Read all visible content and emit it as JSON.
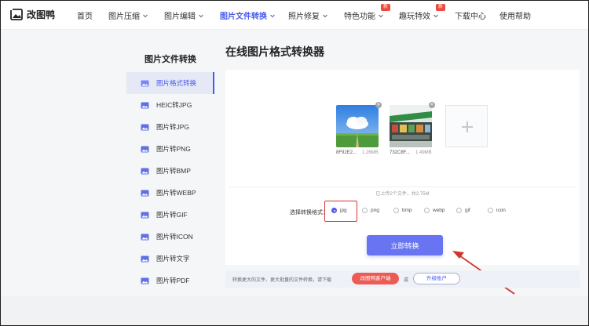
{
  "header": {
    "logo_text": "改图鸭",
    "nav": [
      {
        "label": "首页"
      },
      {
        "label": "图片压缩"
      },
      {
        "label": "图片编辑"
      },
      {
        "label": "图片文件转换"
      },
      {
        "label": "照片修复"
      },
      {
        "label": "特色功能"
      },
      {
        "label": "趣玩特效"
      },
      {
        "label": "下载中心"
      },
      {
        "label": "使用帮助"
      }
    ],
    "badge_new": "新"
  },
  "sidebar": {
    "title": "图片文件转换",
    "items": [
      {
        "label": "图片格式转换"
      },
      {
        "label": "HEIC转JPG"
      },
      {
        "label": "图片转JPG"
      },
      {
        "label": "图片转PNG"
      },
      {
        "label": "图片转BMP"
      },
      {
        "label": "图片转WEBP"
      },
      {
        "label": "图片转GIF"
      },
      {
        "label": "图片转ICON"
      },
      {
        "label": "图片转文字"
      },
      {
        "label": "图片转PDF"
      }
    ]
  },
  "main": {
    "title": "在线图片格式转换器",
    "files": [
      {
        "name": "8F92E2...",
        "size": "1.26MB"
      },
      {
        "name": "732C8F...",
        "size": "1.49MB"
      }
    ],
    "upload_summary": "已上传2个文件，共2.75M",
    "format_label": "选择转换格式：",
    "formats": [
      "jpg",
      "png",
      "bmp",
      "webp",
      "gif",
      "icon"
    ],
    "selected_format": "jpg",
    "convert_button": "立即转换"
  },
  "bottom": {
    "prompt": "转换更大的文件、更大批量的文件转换，请下载",
    "client_button": "改图鸭客户端",
    "or": "或",
    "upgrade_button": "升级账户"
  },
  "colors": {
    "accent": "#4a59f0",
    "button": "#6874f2",
    "badge": "#ec4a3c",
    "annotation": "#d3352e"
  }
}
